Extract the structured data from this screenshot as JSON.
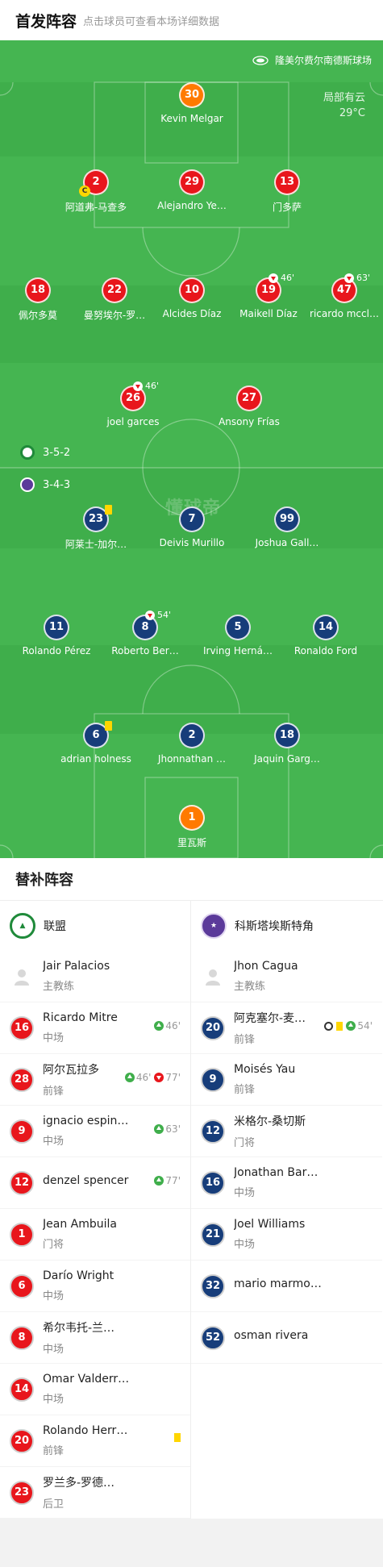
{
  "header": {
    "title": "首发阵容",
    "subtitle": "点击球员可查看本场详细数据"
  },
  "pitch": {
    "stadium": "隆美尔费尔南德斯球场",
    "weather": "局部有云",
    "temperature": "29°C",
    "watermark": "懂球帝",
    "home_formation": "3-5-2",
    "away_formation": "3-4-3",
    "colors": {
      "pitch": "#3fae4b",
      "home": "#e8161c",
      "away": "#173d7a",
      "gk": "#ff7a00"
    }
  },
  "home_lineup": [
    {
      "num": "30",
      "name": "Kevin Melgar"
    },
    {
      "num": "2",
      "name": "阿道弗-马查多",
      "captain": "C"
    },
    {
      "num": "29",
      "name": "Alejandro Ye…"
    },
    {
      "num": "13",
      "name": "门多萨"
    },
    {
      "num": "18",
      "name": "佩尔多莫"
    },
    {
      "num": "22",
      "name": "曼努埃尔-罗…"
    },
    {
      "num": "10",
      "name": "Alcides Díaz"
    },
    {
      "num": "19",
      "name": "Maikell Díaz",
      "sub_out": "46'"
    },
    {
      "num": "47",
      "name": "ricardo mccl…",
      "sub_out": "63'"
    },
    {
      "num": "26",
      "name": "joel garces",
      "sub_out": "46'"
    },
    {
      "num": "27",
      "name": "Ansony Frías"
    }
  ],
  "away_lineup": [
    {
      "num": "23",
      "name": "阿莱士-加尔…"
    },
    {
      "num": "7",
      "name": "Deivis Murillo"
    },
    {
      "num": "99",
      "name": "Joshua Gall…"
    },
    {
      "num": "11",
      "name": "Rolando Pérez"
    },
    {
      "num": "8",
      "name": "Roberto Ber…",
      "sub_out": "54'"
    },
    {
      "num": "5",
      "name": "Irving Herná…"
    },
    {
      "num": "14",
      "name": "Ronaldo Ford"
    },
    {
      "num": "6",
      "name": "adrian holness"
    },
    {
      "num": "2",
      "name": "Jhonnathan …"
    },
    {
      "num": "18",
      "name": "Jaquin Garg…"
    },
    {
      "num": "1",
      "name": "里瓦斯"
    }
  ],
  "bench": {
    "title": "替补阵容",
    "home": {
      "team": "联盟",
      "coach": {
        "name": "Jair Palacios",
        "role": "主教练"
      },
      "players": [
        {
          "num": "16",
          "name": "Ricardo Mitre",
          "pos": "中场",
          "in": "46'"
        },
        {
          "num": "28",
          "name": "阿尔瓦拉多",
          "pos": "前锋",
          "in": "46'",
          "out": "77'"
        },
        {
          "num": "9",
          "name": "ignacio espin…",
          "pos": "中场",
          "in": "63'"
        },
        {
          "num": "12",
          "name": "denzel spencer",
          "pos": "",
          "in": "77'"
        },
        {
          "num": "1",
          "name": "Jean Ambuila",
          "pos": "门将"
        },
        {
          "num": "6",
          "name": "Darío Wright",
          "pos": "中场"
        },
        {
          "num": "8",
          "name": "希尔韦托-兰…",
          "pos": "中场"
        },
        {
          "num": "14",
          "name": "Omar Valderr…",
          "pos": "中场"
        },
        {
          "num": "20",
          "name": "Rolando Herr…",
          "pos": "前锋"
        },
        {
          "num": "23",
          "name": "罗兰多-罗德…",
          "pos": "后卫"
        }
      ]
    },
    "away": {
      "team": "科斯塔埃斯特角",
      "coach": {
        "name": "Jhon Cagua",
        "role": "主教练"
      },
      "players": [
        {
          "num": "20",
          "name": "阿克塞尔-麦…",
          "pos": "前锋",
          "in": "54'"
        },
        {
          "num": "9",
          "name": "Moisés Yau",
          "pos": "前锋"
        },
        {
          "num": "12",
          "name": "米格尔-桑切斯",
          "pos": "门将"
        },
        {
          "num": "16",
          "name": "Jonathan Bar…",
          "pos": "中场"
        },
        {
          "num": "21",
          "name": "Joel Williams",
          "pos": "中场"
        },
        {
          "num": "32",
          "name": "mario marmol…",
          "pos": ""
        },
        {
          "num": "52",
          "name": "osman rivera",
          "pos": ""
        }
      ]
    }
  }
}
